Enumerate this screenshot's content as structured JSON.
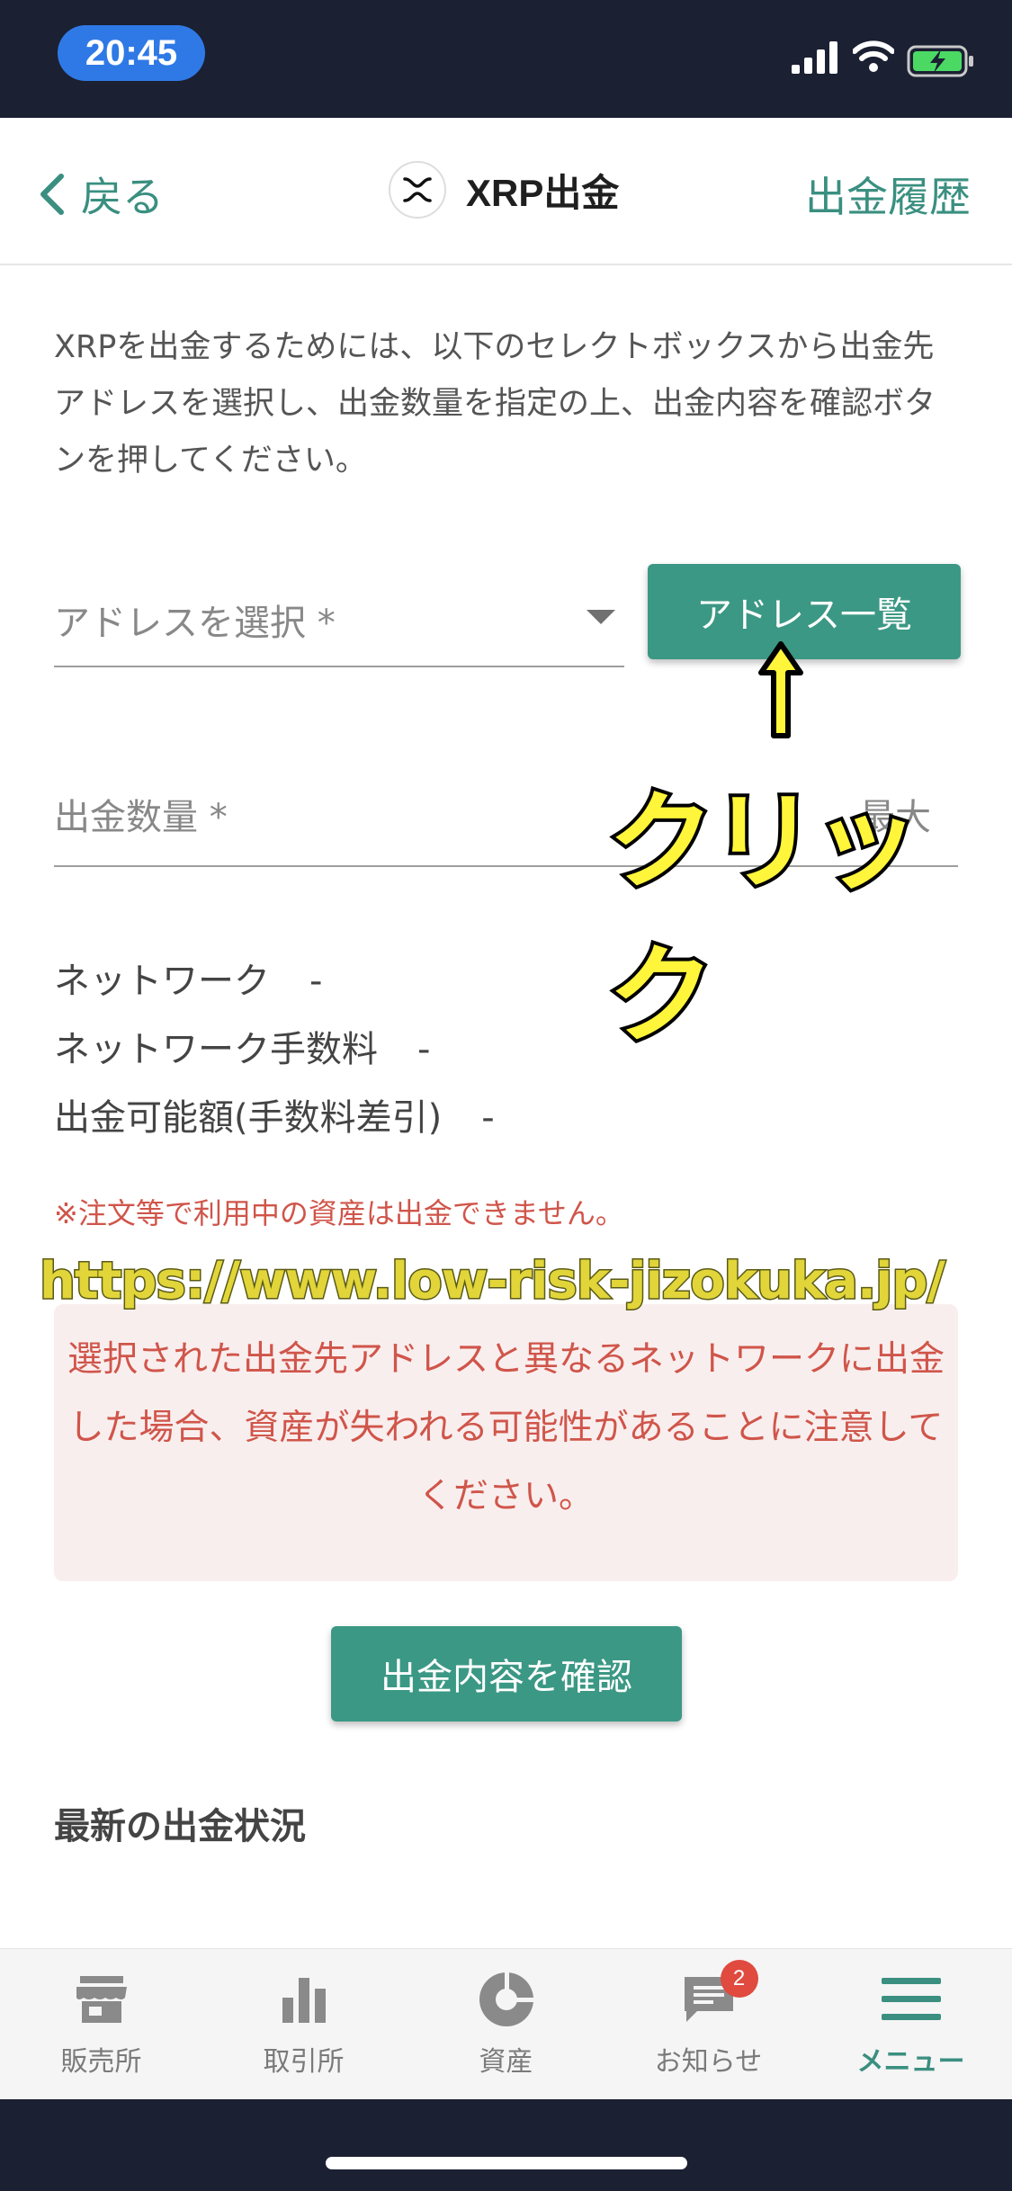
{
  "status": {
    "time": "20:45"
  },
  "nav": {
    "back_label": "戻る",
    "title": "XRP出金",
    "history_label": "出金履歴"
  },
  "description": "XRPを出金するためには、以下のセレクトボックスから出金先アドレスを選択し、出金数量を指定の上、出金内容を確認ボタンを押してください。",
  "address": {
    "placeholder": "アドレスを選択 *",
    "list_button": "アドレス一覧"
  },
  "amount": {
    "placeholder": "出金数量 *",
    "max_label": "最大"
  },
  "annotation": {
    "click": "クリック",
    "watermark": "https://www.low-risk-jizokuka.jp/"
  },
  "info": {
    "network_label": "ネットワーク",
    "network_value": "-",
    "fee_label": "ネットワーク手数料",
    "fee_value": "-",
    "available_label": "出金可能額(手数料差引)",
    "available_value": "-"
  },
  "note": "※注文等で利用中の資産は出金できません。",
  "warning": "選択された出金先アドレスと異なるネットワークに出金した場合、資産が失われる可能性があることに注意してください。",
  "confirm_button": "出金内容を確認",
  "latest_heading": "最新の出金状況",
  "tabs": [
    {
      "label": "販売所",
      "icon": "store-icon"
    },
    {
      "label": "取引所",
      "icon": "bar-chart-icon"
    },
    {
      "label": "資産",
      "icon": "pie-chart-icon"
    },
    {
      "label": "お知らせ",
      "icon": "message-icon",
      "badge": "2"
    },
    {
      "label": "メニュー",
      "icon": "menu-icon",
      "active": true
    }
  ],
  "colors": {
    "accent": "#3b9884",
    "warning": "#d0554a",
    "statusbar": "#1b2032"
  }
}
